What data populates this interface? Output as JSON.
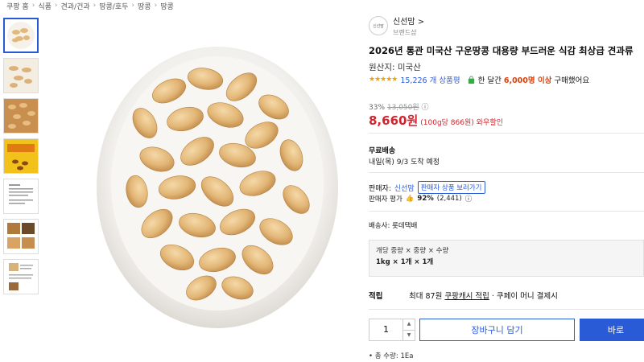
{
  "breadcrumb": [
    "쿠팡 홈",
    "식품",
    "견과/건과",
    "땅콩/호두",
    "땅콩",
    "땅콩"
  ],
  "brand": {
    "logo_text": "신선맘",
    "name": "신선맘 >",
    "sub": "브랜드샵"
  },
  "product": {
    "title": "2026년 통관 미국산 구운땅콩 대용량 부드러운 식감 최상급 견과류",
    "origin": "원산지: 미국산",
    "stars": "★★★★★",
    "review_count": "15,226 개 상품평",
    "bought_prefix": "한 달간",
    "bought_highlight": "6,000명 이상",
    "bought_suffix": "구매했어요"
  },
  "price": {
    "discount": "33%",
    "original": "13,050원",
    "info_icon": "ⓘ",
    "final": "8,660원",
    "unit_price": "(100g당 866원)",
    "tag": "와우할인"
  },
  "shipping": {
    "title": "무료배송",
    "date": "내일(목) 9/3 도착 예정"
  },
  "seller": {
    "label": "판매자:",
    "name": "신선맘",
    "button": "판매자 상품 보러가기",
    "rating_label": "판매자 평가",
    "rating_value": "92%",
    "rating_count": "(2,441)",
    "rating_info": "ⓘ"
  },
  "carrier": "배송사: 롯데택배",
  "option": {
    "label": "개당 중량 × 중량 × 수량",
    "value": "1kg × 1개 × 1개"
  },
  "points": {
    "label": "적립",
    "text1": "최대 87원",
    "link": "쿠팡캐시 적립",
    "text2": "· 쿠페이 머니 결제시"
  },
  "quantity": "1",
  "buttons": {
    "cart": "장바구니 담기",
    "buy": "바로"
  },
  "qty_note": "• 총 수량: 1Ea"
}
